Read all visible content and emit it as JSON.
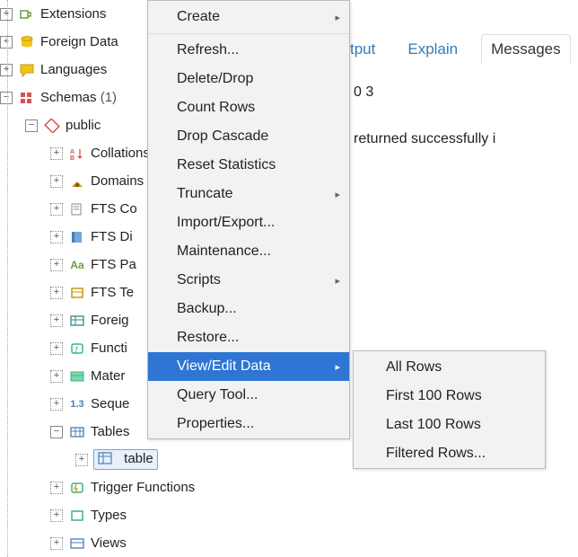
{
  "tree": {
    "extensions": "Extensions",
    "foreign_data": "Foreign Data",
    "languages": "Languages",
    "schemas_label": "Schemas",
    "schemas_count": "(1)",
    "public": "public",
    "collations": "Collations",
    "domains": "Domains",
    "fts_co": "FTS Co",
    "fts_di": "FTS Di",
    "fts_pa": "FTS Pa",
    "fts_te": "FTS Te",
    "foreig": "Foreig",
    "functi": "Functi",
    "mater": "Mater",
    "seque": "Seque",
    "tables": "Tables",
    "table_item": "table",
    "trigger_functions": "Trigger Functions",
    "types": "Types",
    "views": "Views"
  },
  "tabs": {
    "output": "tput",
    "explain": "Explain",
    "messages": "Messages"
  },
  "output": {
    "line1": "0 3",
    "line2": "returned successfully i"
  },
  "context_menu": {
    "create": "Create",
    "refresh": "Refresh...",
    "delete_drop": "Delete/Drop",
    "count_rows": "Count Rows",
    "drop_cascade": "Drop Cascade",
    "reset_statistics": "Reset Statistics",
    "truncate": "Truncate",
    "import_export": "Import/Export...",
    "maintenance": "Maintenance...",
    "scripts": "Scripts",
    "backup": "Backup...",
    "restore": "Restore...",
    "view_edit_data": "View/Edit Data",
    "query_tool": "Query Tool...",
    "properties": "Properties..."
  },
  "submenu": {
    "all_rows": "All Rows",
    "first_100": "First 100 Rows",
    "last_100": "Last 100 Rows",
    "filtered": "Filtered Rows..."
  },
  "icons": {
    "plus": "+",
    "minus": "−",
    "arrow": "▸"
  }
}
